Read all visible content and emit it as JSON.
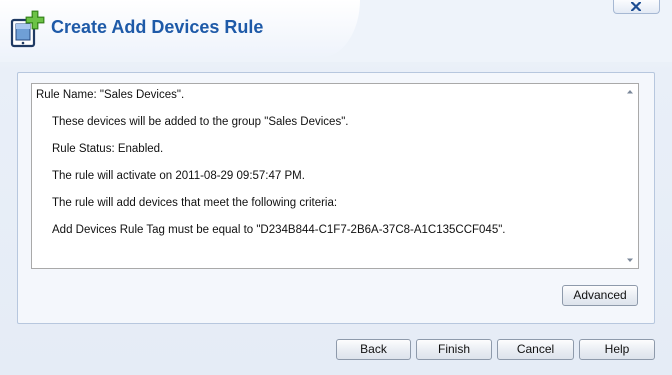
{
  "dialog": {
    "title": "Create Add Devices Rule",
    "close_icon": "close-icon",
    "header_icon": "add-device-icon"
  },
  "summary": {
    "lines": [
      "Rule Name: \"Sales Devices\".",
      "These devices will be added to the group \"Sales Devices\".",
      "Rule Status: Enabled.",
      "The rule will activate on 2011-08-29 09:57:47 PM.",
      "The rule will add devices that meet the following criteria:",
      "Add Devices Rule Tag must be equal to \"D234B844-C1F7-2B6A-37C8-A1C135CCF045\"."
    ]
  },
  "buttons": {
    "advanced": "Advanced",
    "back": "Back",
    "finish": "Finish",
    "cancel": "Cancel",
    "help": "Help"
  },
  "colors": {
    "title": "#1e5aa8",
    "background": "#e8eef8",
    "icon_plus": "#4ea32a"
  }
}
